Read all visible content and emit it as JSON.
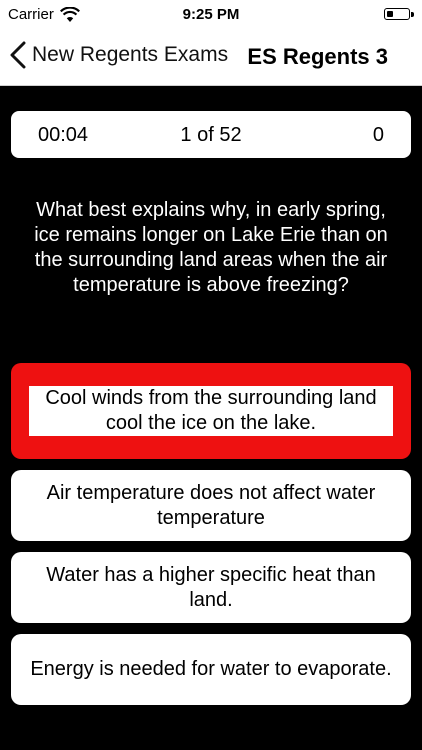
{
  "status_bar": {
    "carrier": "Carrier",
    "time": "9:25 PM",
    "battery_level": 0.3
  },
  "nav": {
    "back_label": "New Regents Exams",
    "title": "ES Regents 3"
  },
  "quiz": {
    "timer": "00:04",
    "progress": "1 of 52",
    "score": "0"
  },
  "question": {
    "text": "What best explains why, in early spring, ice remains longer on Lake Erie than on the surrounding land areas when the air temperature is above freezing?"
  },
  "answers": [
    {
      "text": "Cool winds from the surrounding land cool the ice on the lake.",
      "state": "wrong",
      "color": "#ee1111"
    },
    {
      "text": "Air temperature does not affect water temperature",
      "state": "default",
      "color": "#ffffff"
    },
    {
      "text": "Water has a higher specific heat than land.",
      "state": "default",
      "color": "#ffffff"
    },
    {
      "text": "Energy is needed for water to evaporate.",
      "state": "default",
      "color": "#ffffff"
    }
  ]
}
